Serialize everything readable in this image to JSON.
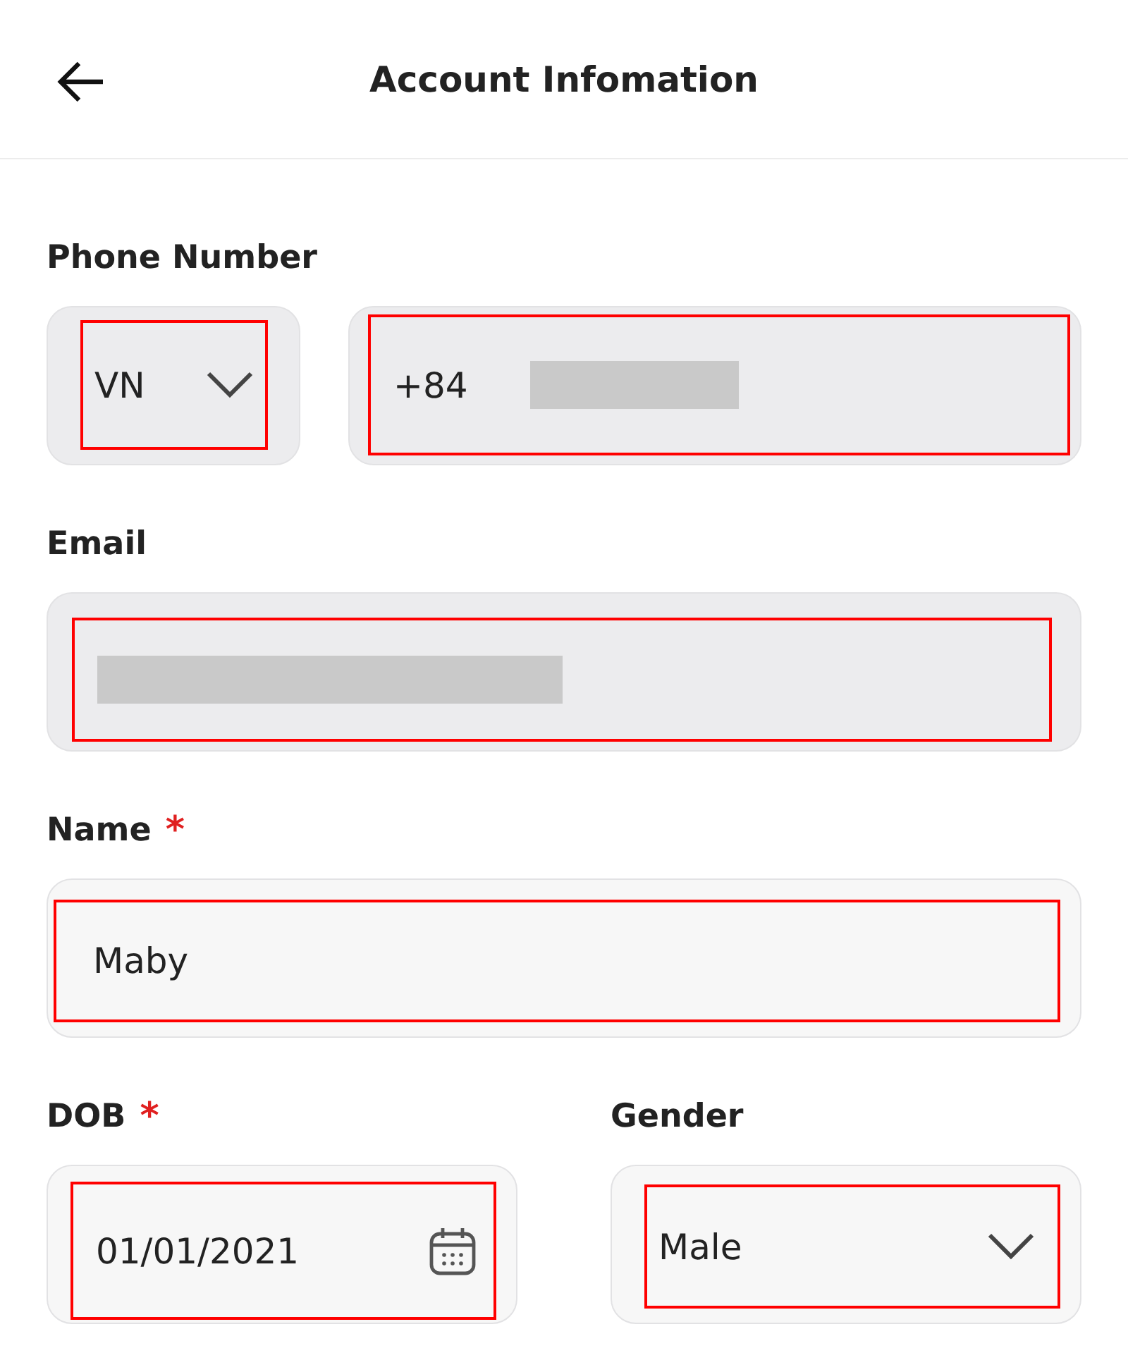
{
  "header": {
    "title": "Account Infomation"
  },
  "phone": {
    "label": "Phone Number",
    "country": {
      "value": "VN",
      "kind": "readonly",
      "highlighted": true
    },
    "number": {
      "prefix": "+84",
      "redacted": true,
      "kind": "readonly",
      "highlighted": true
    }
  },
  "email": {
    "label": "Email",
    "redacted": true,
    "kind": "readonly",
    "highlighted": true
  },
  "name": {
    "label": "Name",
    "required_mark": "*",
    "value": "Maby",
    "kind": "editable",
    "highlighted": true
  },
  "dob": {
    "label": "DOB",
    "required_mark": "*",
    "value": "01/01/2021",
    "kind": "editable",
    "highlighted": true
  },
  "gender": {
    "label": "Gender",
    "value": "Male",
    "kind": "editable",
    "highlighted": true
  }
}
